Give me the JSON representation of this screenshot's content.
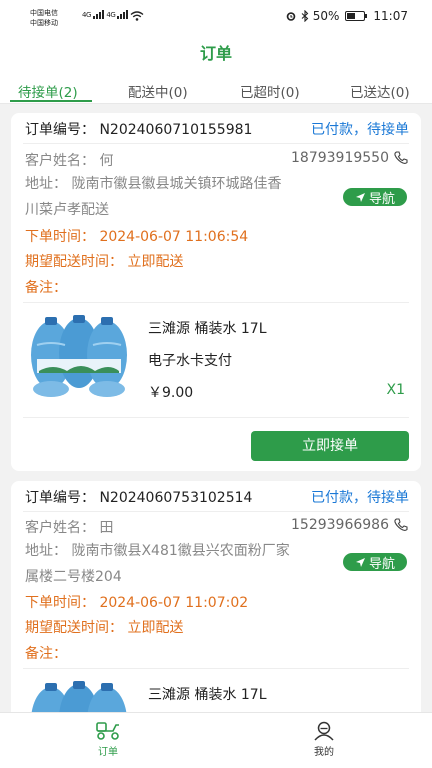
{
  "status_bar": {
    "carrier_1": "中国电信",
    "carrier_2": "中国移动",
    "net_1": "4G",
    "net_2": "4G",
    "battery": "50%",
    "time": "11:07"
  },
  "header": {
    "title": "订单"
  },
  "tabs": [
    {
      "label": "待接单(2)",
      "active": true
    },
    {
      "label": "配送中(0)",
      "active": false
    },
    {
      "label": "已超时(0)",
      "active": false
    },
    {
      "label": "已送达(0)",
      "active": false
    }
  ],
  "orders": [
    {
      "order_no": "订单编号： N2024060710155981",
      "pay_status": "已付款，待接单",
      "customer": "客户姓名：  何",
      "phone": "18793919550",
      "address_line1": "地址：  陇南市徽县徽县城关镇环城路佳香",
      "address_line2": "川菜卢孝配送",
      "nav_label": "导航",
      "order_time": "下单时间：  2024-06-07 11:06:54",
      "expected_time": "期望配送时间：  立即配送",
      "remark": "备注：",
      "goods": {
        "name": "三滩源 桶装水 17L",
        "payment": "电子水卡支付",
        "price": "￥9.00",
        "qty": "X1"
      },
      "accept_label": "立即接单"
    },
    {
      "order_no": "订单编号： N2024060753102514",
      "pay_status": "已付款，待接单",
      "customer": "客户姓名：  田",
      "phone": "15293966986",
      "address_line1": "地址：  陇南市徽县X481徽县兴农面粉厂家",
      "address_line2": "属楼二号楼204",
      "nav_label": "导航",
      "order_time": "下单时间：  2024-06-07 11:07:02",
      "expected_time": "期望配送时间：  立即配送",
      "remark": "备注：",
      "goods": {
        "name": "三滩源 桶装水 17L"
      }
    }
  ],
  "bottom_nav": [
    {
      "label": "订单",
      "active": true,
      "icon": "delivery-scooter-icon"
    },
    {
      "label": "我的",
      "active": false,
      "icon": "user-icon"
    }
  ],
  "colors": {
    "accent": "#2e9c4a",
    "link": "#1a78d6",
    "warn": "#e0701e"
  }
}
